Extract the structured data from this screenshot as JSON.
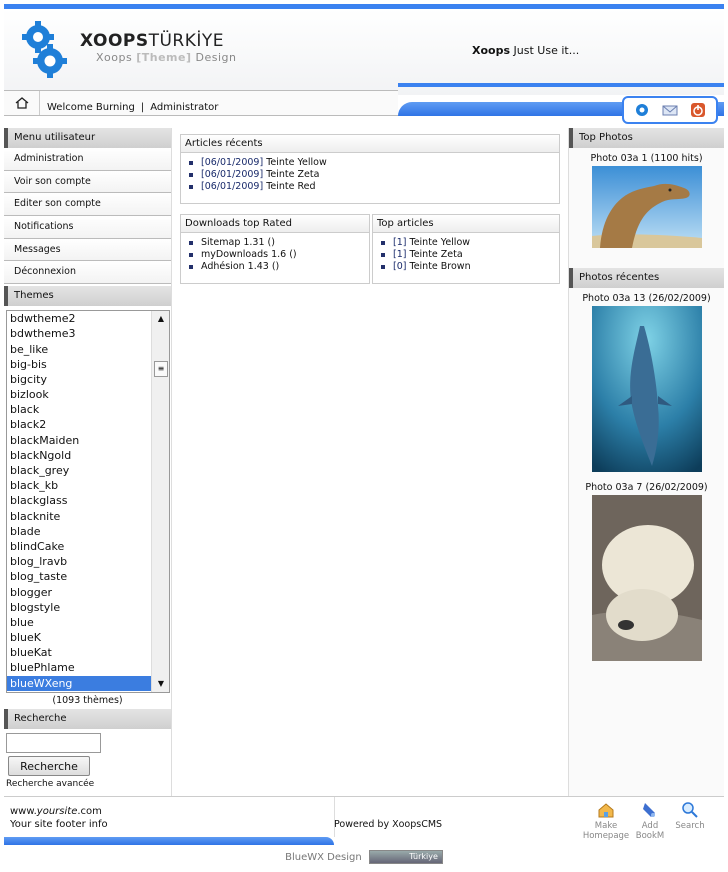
{
  "header": {
    "logo_main": "XOOPS",
    "logo_main_suffix": "TÜRKİYE",
    "logo_sub_prefix": "Xoops ",
    "logo_sub_bracket": "[Theme]",
    "logo_sub_suffix": " Design",
    "tagline_bold": "Xoops",
    "tagline_rest": " Just Use it..."
  },
  "userbar": {
    "welcome": "Welcome Burning",
    "separator": "|",
    "role": "Administrator"
  },
  "user_menu": {
    "title": "Menu utilisateur",
    "items": [
      "Administration",
      "Voir son compte",
      "Editer son compte",
      "Notifications",
      "Messages",
      "Déconnexion"
    ]
  },
  "themes": {
    "title": "Themes",
    "options": [
      "bdwtheme2",
      "bdwtheme3",
      "be_like",
      "big-bis",
      "bigcity",
      "bizlook",
      "black",
      "black2",
      "blackMaiden",
      "blackNgold",
      "black_grey",
      "black_kb",
      "blackglass",
      "blacknite",
      "blade",
      "blindCake",
      "blog_lravb",
      "blog_taste",
      "blogger",
      "blogstyle",
      "blue",
      "blueK",
      "blueKat",
      "bluePhlame",
      "blueWXeng"
    ],
    "selected": "blueWXeng",
    "count": "(1093 thèmes)"
  },
  "search": {
    "title": "Recherche",
    "button": "Recherche",
    "advanced": "Recherche avancée"
  },
  "recent_articles": {
    "title": "Articles récents",
    "items": [
      {
        "date": "[06/01/2009]",
        "name": "Teinte Yellow"
      },
      {
        "date": "[06/01/2009]",
        "name": "Teinte Zeta"
      },
      {
        "date": "[06/01/2009]",
        "name": "Teinte Red"
      }
    ]
  },
  "downloads": {
    "title": "Downloads top Rated",
    "items": [
      "Sitemap 1.31 ()",
      "myDownloads 1.6 ()",
      "Adhésion 1.43 ()"
    ]
  },
  "top_articles": {
    "title": "Top articles",
    "items": [
      {
        "count": "[1]",
        "name": "Teinte Yellow"
      },
      {
        "count": "[1]",
        "name": "Teinte Zeta"
      },
      {
        "count": "[0]",
        "name": "Teinte Brown"
      }
    ]
  },
  "top_photos": {
    "title": "Top Photos",
    "items": [
      {
        "caption": "Photo 03a 1 (1100 hits)"
      }
    ]
  },
  "recent_photos": {
    "title": "Photos récentes",
    "items": [
      {
        "caption": "Photo 03a 13 (26/02/2009)"
      },
      {
        "caption": "Photo 03a 7 (26/02/2009)"
      }
    ]
  },
  "footer": {
    "site_prefix": "www.",
    "site_italic": "yoursite",
    "site_suffix": ".com",
    "info": "Your site footer info",
    "powered": "Powered by XoopsCMS",
    "actions": [
      {
        "label1": "Make",
        "label2": "Homepage",
        "icon": "house-icon"
      },
      {
        "label1": "Add",
        "label2": "BookM",
        "icon": "bookmark-icon"
      },
      {
        "label1": "Search",
        "label2": "",
        "icon": "search-icon"
      }
    ]
  },
  "credits": {
    "text": "BlueWX Design",
    "badge": "Türkiye"
  },
  "colors": {
    "accent": "#3b82f0",
    "selection": "#3b7de0",
    "link": "#1a2b6b"
  }
}
